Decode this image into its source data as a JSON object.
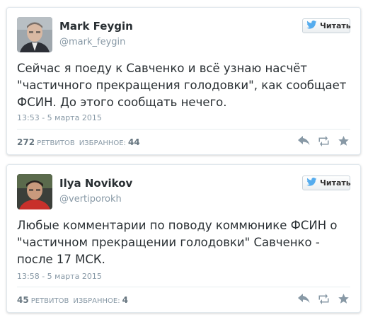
{
  "tweets": [
    {
      "author_name": "Mark Feygin",
      "handle": "@mark_feygin",
      "follow_label": "Читать",
      "text": "Сейчас я поеду к Савченко и всё узнаю насчёт \"частичного прекращения голодовки\", как сообщает ФСИН. До этого сообщать нечего.",
      "timestamp": "13:53 - 5 марта 2015",
      "retweets_count": "272",
      "retweets_label": "РЕТВИТОВ",
      "favorites_label": "ИЗБРАННОЕ:",
      "favorites_count": "44"
    },
    {
      "author_name": "Ilya Novikov",
      "handle": "@vertiporokh",
      "follow_label": "Читать",
      "text": "Любые комментарии по поводу коммюнике ФСИН о \"частичном прекращении голодовки\" Савченко - после 17 МСК.",
      "timestamp": "13:58 - 5 марта 2015",
      "retweets_count": "45",
      "retweets_label": "РЕТВИТОВ",
      "favorites_label": "ИЗБРАННОЕ:",
      "favorites_count": "4"
    }
  ],
  "icons": {
    "follow": "twitter-bird-icon",
    "reply": "reply-icon",
    "retweet": "retweet-icon",
    "favorite": "star-icon"
  },
  "colors": {
    "text": "#292f33",
    "muted": "#8899a6",
    "icon": "#8899a6",
    "twitter_blue": "#55acee",
    "border": "#e1e8ed"
  }
}
